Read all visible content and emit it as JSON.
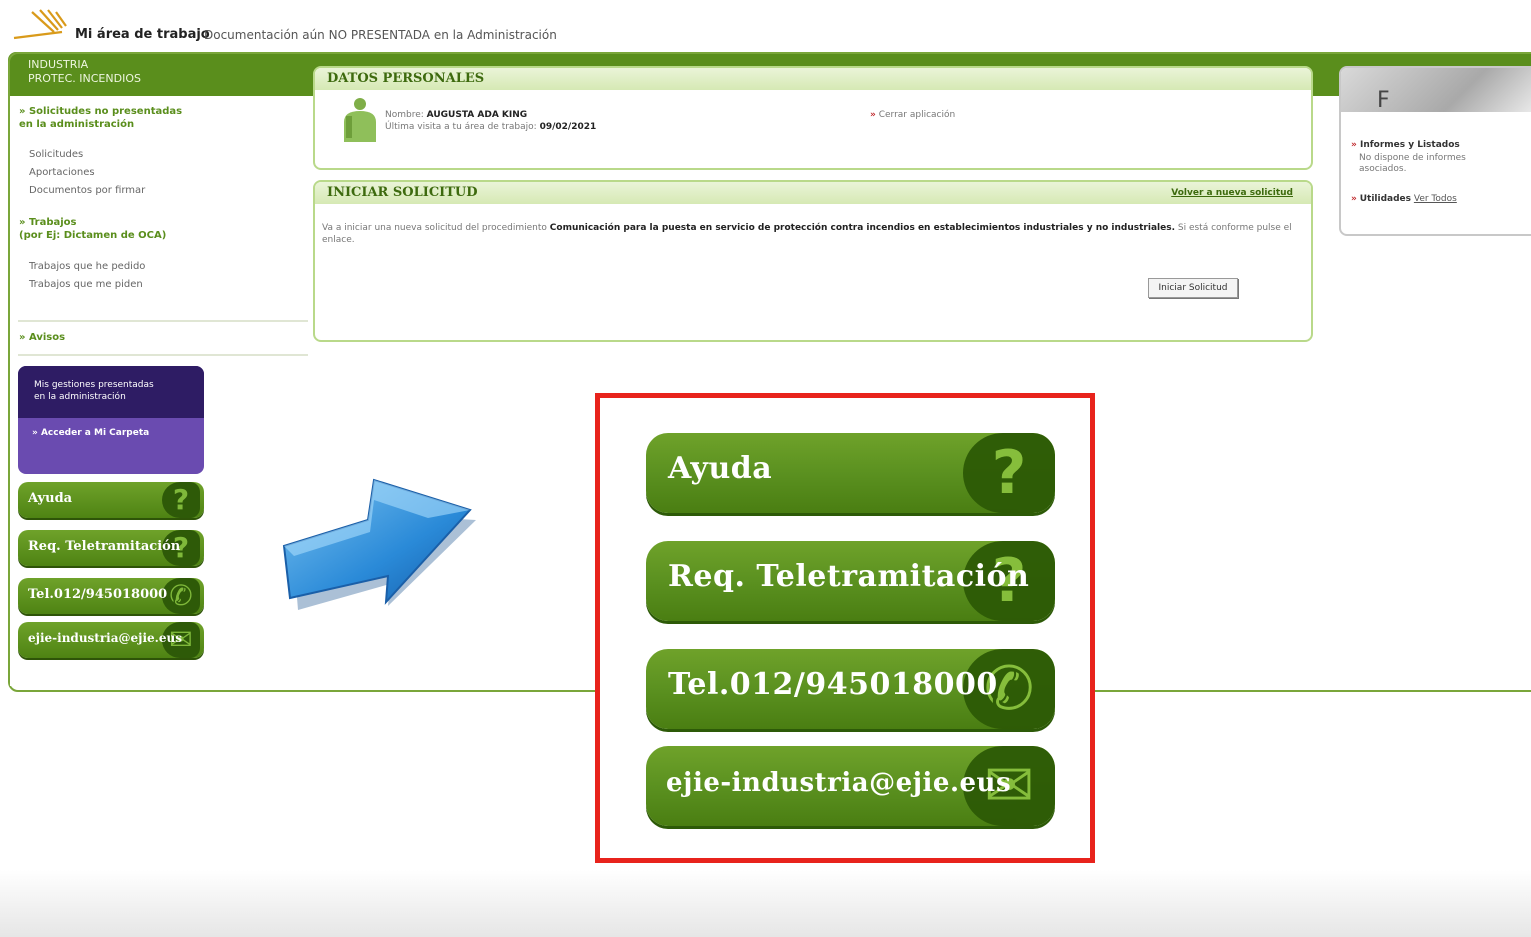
{
  "header": {
    "title": "Mi área de trabajo",
    "subtitle": "Documentación aún NO PRESENTADA en la Administración"
  },
  "sidebar": {
    "section_title": "INDUSTRIA\nPROTEC. INCENDIOS",
    "group1_head": "» Solicitudes no presentadas\nen la administración",
    "group1_items": [
      "Solicitudes",
      "Aportaciones",
      "Documentos por firmar"
    ],
    "group2_head": "» Trabajos\n(por Ej: Dictamen de OCA)",
    "group2_items": [
      "Trabajos que he pedido",
      "Trabajos que me piden"
    ],
    "avisos": "» Avisos",
    "purple_text": "Mis gestiones presentadas\nen la administración",
    "purple_link": "» Acceder a Mi Carpeta",
    "buttons": [
      "Ayuda",
      "Req. Teletramitación",
      "Tel.012/945018000",
      "ejie-industria@ejie.eus"
    ]
  },
  "datos": {
    "title": "DATOS PERSONALES",
    "nombre_label": "Nombre:",
    "nombre_value": "AUGUSTA ADA KING",
    "visita_label": "Última visita a tu área de trabajo:",
    "visita_value": "09/02/2021",
    "cerrar": "Cerrar aplicación"
  },
  "iniciar": {
    "title": "INICIAR SOLICITUD",
    "volver": "Volver a nueva solicitud",
    "text_pre": "Va a iniciar una nueva solicitud del procedimiento",
    "text_bold": "Comunicación para la puesta en servicio de protección contra incendios en establecimientos industriales y no industriales.",
    "text_post": "Si está conforme pulse el enlace.",
    "button": "Iniciar Solicitud"
  },
  "right": {
    "img_letter": "F",
    "informes_title": "Informes y Listados",
    "informes_text": "No dispone de informes asociados.",
    "utilidades": "Utilidades",
    "ver_todos": "Ver Todos"
  },
  "zoom": {
    "buttons": [
      "Ayuda",
      "Req. Teletramitación",
      "Tel.012/945018000",
      "ejie-industria@ejie.eus"
    ]
  },
  "icons": [
    "logo-icon",
    "person-icon",
    "help-icon",
    "phone-icon",
    "mail-icon",
    "arrow-icon"
  ],
  "colors": {
    "green": "#5a8e1c",
    "dark_green": "#2d5a06",
    "purple": "#2e1c64",
    "red_frame": "#e8231c"
  }
}
